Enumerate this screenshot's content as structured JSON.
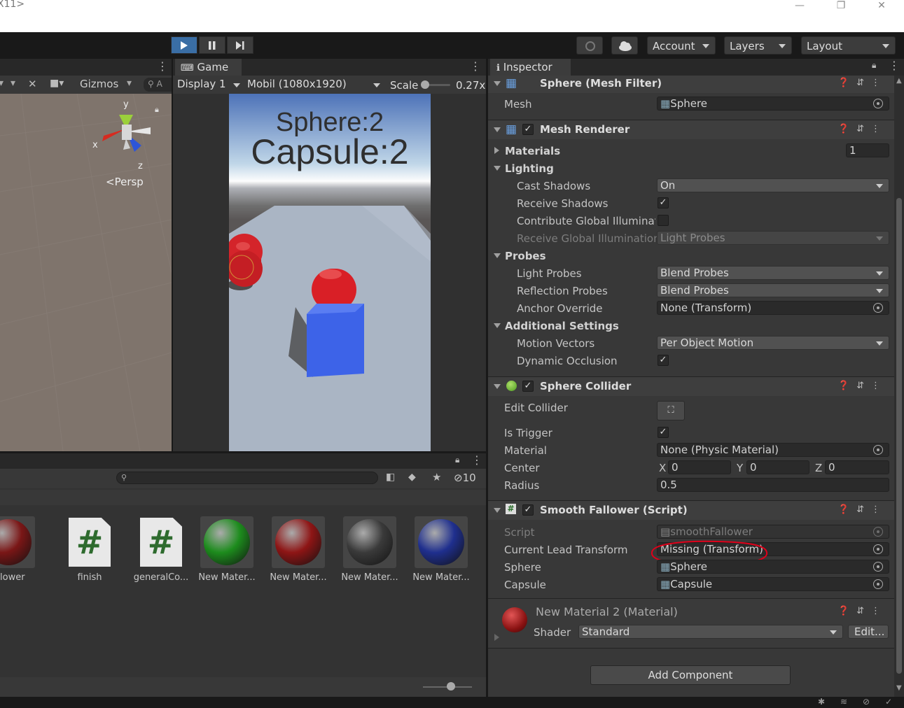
{
  "window": {
    "title": "X11>"
  },
  "toolbar": {
    "account_label": "Account",
    "layers_label": "Layers",
    "layout_label": "Layout"
  },
  "scene": {
    "gizmos_label": "Gizmos",
    "search_hint": "A",
    "persp_label": "Persp",
    "axis_x": "x",
    "axis_y": "y",
    "axis_z": "z"
  },
  "game": {
    "tab_label": "Game",
    "display_label": "Display 1",
    "resolution_label": "Mobil (1080x1920)",
    "scale_label": "Scale",
    "scale_value": "0.27x",
    "scale_slider_fraction": 0.05,
    "score_sphere": "Sphere:2",
    "score_capsule": "Capsule:2"
  },
  "project": {
    "hidden_count": "10",
    "assets": [
      {
        "name": "allower",
        "kind": "material",
        "color": "#7a1616"
      },
      {
        "name": "finish",
        "kind": "script"
      },
      {
        "name": "generalCo...",
        "kind": "script"
      },
      {
        "name": "New Mater...",
        "kind": "material",
        "color": "#1d8c1d"
      },
      {
        "name": "New Mater...",
        "kind": "material",
        "color": "#8e1515"
      },
      {
        "name": "New Mater...",
        "kind": "material",
        "color": "#3a3a3a"
      },
      {
        "name": "New Mater...",
        "kind": "material",
        "color": "#1f2f8e"
      }
    ]
  },
  "inspector": {
    "tab_label": "Inspector",
    "mesh_filter": {
      "title": "Sphere (Mesh Filter)",
      "mesh_label": "Mesh",
      "mesh_value": "Sphere"
    },
    "mesh_renderer": {
      "title": "Mesh Renderer",
      "enabled": true,
      "materials_label": "Materials",
      "materials_count": "1",
      "lighting_label": "Lighting",
      "cast_shadows_label": "Cast Shadows",
      "cast_shadows_value": "On",
      "receive_shadows_label": "Receive Shadows",
      "receive_shadows": true,
      "contribute_gi_label": "Contribute Global Illuminatio",
      "contribute_gi": false,
      "receive_gi_label": "Receive Global Illumination",
      "receive_gi_value": "Light Probes",
      "probes_label": "Probes",
      "light_probes_label": "Light Probes",
      "light_probes_value": "Blend Probes",
      "reflection_probes_label": "Reflection Probes",
      "reflection_probes_value": "Blend Probes",
      "anchor_override_label": "Anchor Override",
      "anchor_override_value": "None (Transform)",
      "additional_settings_label": "Additional Settings",
      "motion_vectors_label": "Motion Vectors",
      "motion_vectors_value": "Per Object Motion",
      "dynamic_occlusion_label": "Dynamic Occlusion",
      "dynamic_occlusion": true
    },
    "sphere_collider": {
      "title": "Sphere Collider",
      "enabled": true,
      "edit_collider_label": "Edit Collider",
      "is_trigger_label": "Is Trigger",
      "is_trigger": true,
      "material_label": "Material",
      "material_value": "None (Physic Material)",
      "center_label": "Center",
      "center_x_label": "X",
      "center_x": "0",
      "center_y_label": "Y",
      "center_y": "0",
      "center_z_label": "Z",
      "center_z": "0",
      "radius_label": "Radius",
      "radius_value": "0.5"
    },
    "smooth_fallower": {
      "title": "Smooth Fallower (Script)",
      "enabled": true,
      "script_label": "Script",
      "script_value": "smoothFallower",
      "current_lead_label": "Current Lead Transform",
      "current_lead_value": "Missing (Transform)",
      "sphere_label": "Sphere",
      "sphere_value": "Sphere",
      "capsule_label": "Capsule",
      "capsule_value": "Capsule"
    },
    "material": {
      "title": "New Material 2 (Material)",
      "shader_label": "Shader",
      "shader_value": "Standard",
      "edit_label": "Edit..."
    },
    "add_component_label": "Add Component"
  },
  "colors": {
    "play_active": "#3a6ea5",
    "panel": "#383838",
    "annotation_red": "#e0001a"
  }
}
